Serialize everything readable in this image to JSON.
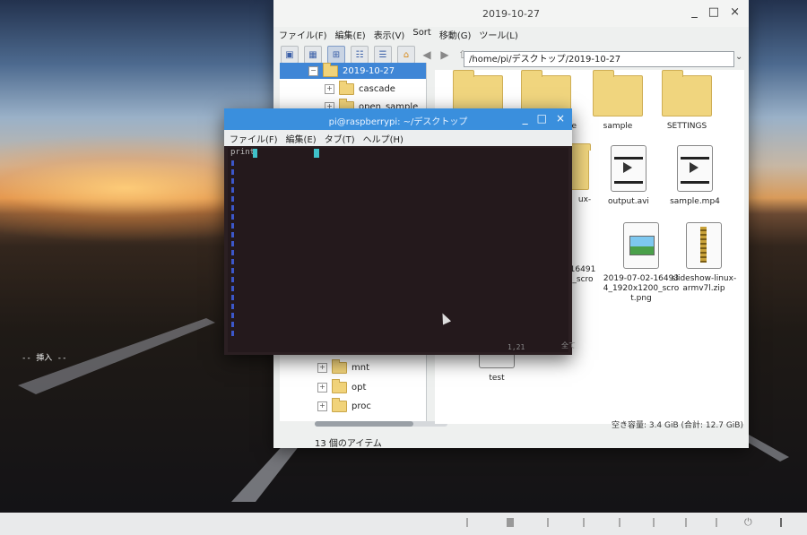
{
  "file_manager": {
    "title": "2019-10-27",
    "window_controls": [
      "_",
      "□",
      "×"
    ],
    "menu": [
      "ファイル(F)",
      "編集(E)",
      "表示(V)",
      "Sort",
      "移動(G)",
      "ツール(L)"
    ],
    "path": "/home/pi/デスクトップ/2019-10-27",
    "tree": [
      {
        "label": "2019-10-27",
        "selected": true
      },
      {
        "label": "cascade"
      },
      {
        "label": "open_sample"
      },
      {
        "label": "mnt"
      },
      {
        "label": "opt"
      },
      {
        "label": "proc"
      }
    ],
    "items": [
      {
        "label": "",
        "type": "folder"
      },
      {
        "label": "le",
        "type": "folder"
      },
      {
        "label": "sample",
        "type": "folder"
      },
      {
        "label": "SETTINGS",
        "type": "folder"
      },
      {
        "label": "ux-",
        "type": "folder"
      },
      {
        "label": "output.avi",
        "type": "video"
      },
      {
        "label": "sample.mp4",
        "type": "video"
      },
      {
        "label": "16491 _scro",
        "type": "image"
      },
      {
        "label": "2019-07-02-16493 4_1920x1200_scro t.png",
        "type": "image"
      },
      {
        "label": "slideshow-linux- armv7l.zip",
        "type": "zip"
      },
      {
        "label": "test",
        "type": "text"
      }
    ],
    "status_count": "13 個のアイテム",
    "status_free": "空き容量: 3.4 GiB (合計: 12.7 GiB)"
  },
  "terminal": {
    "title": "pi@raspberrypi: ~/デスクトップ",
    "window_controls": [
      "_",
      "□",
      "×"
    ],
    "menu": [
      "ファイル(F)",
      "編集(E)",
      "タブ(T)",
      "ヘルプ(H)"
    ],
    "first_line": "print",
    "mode": "-- 挿入 --",
    "position": "1,21",
    "scroll": "全て"
  }
}
